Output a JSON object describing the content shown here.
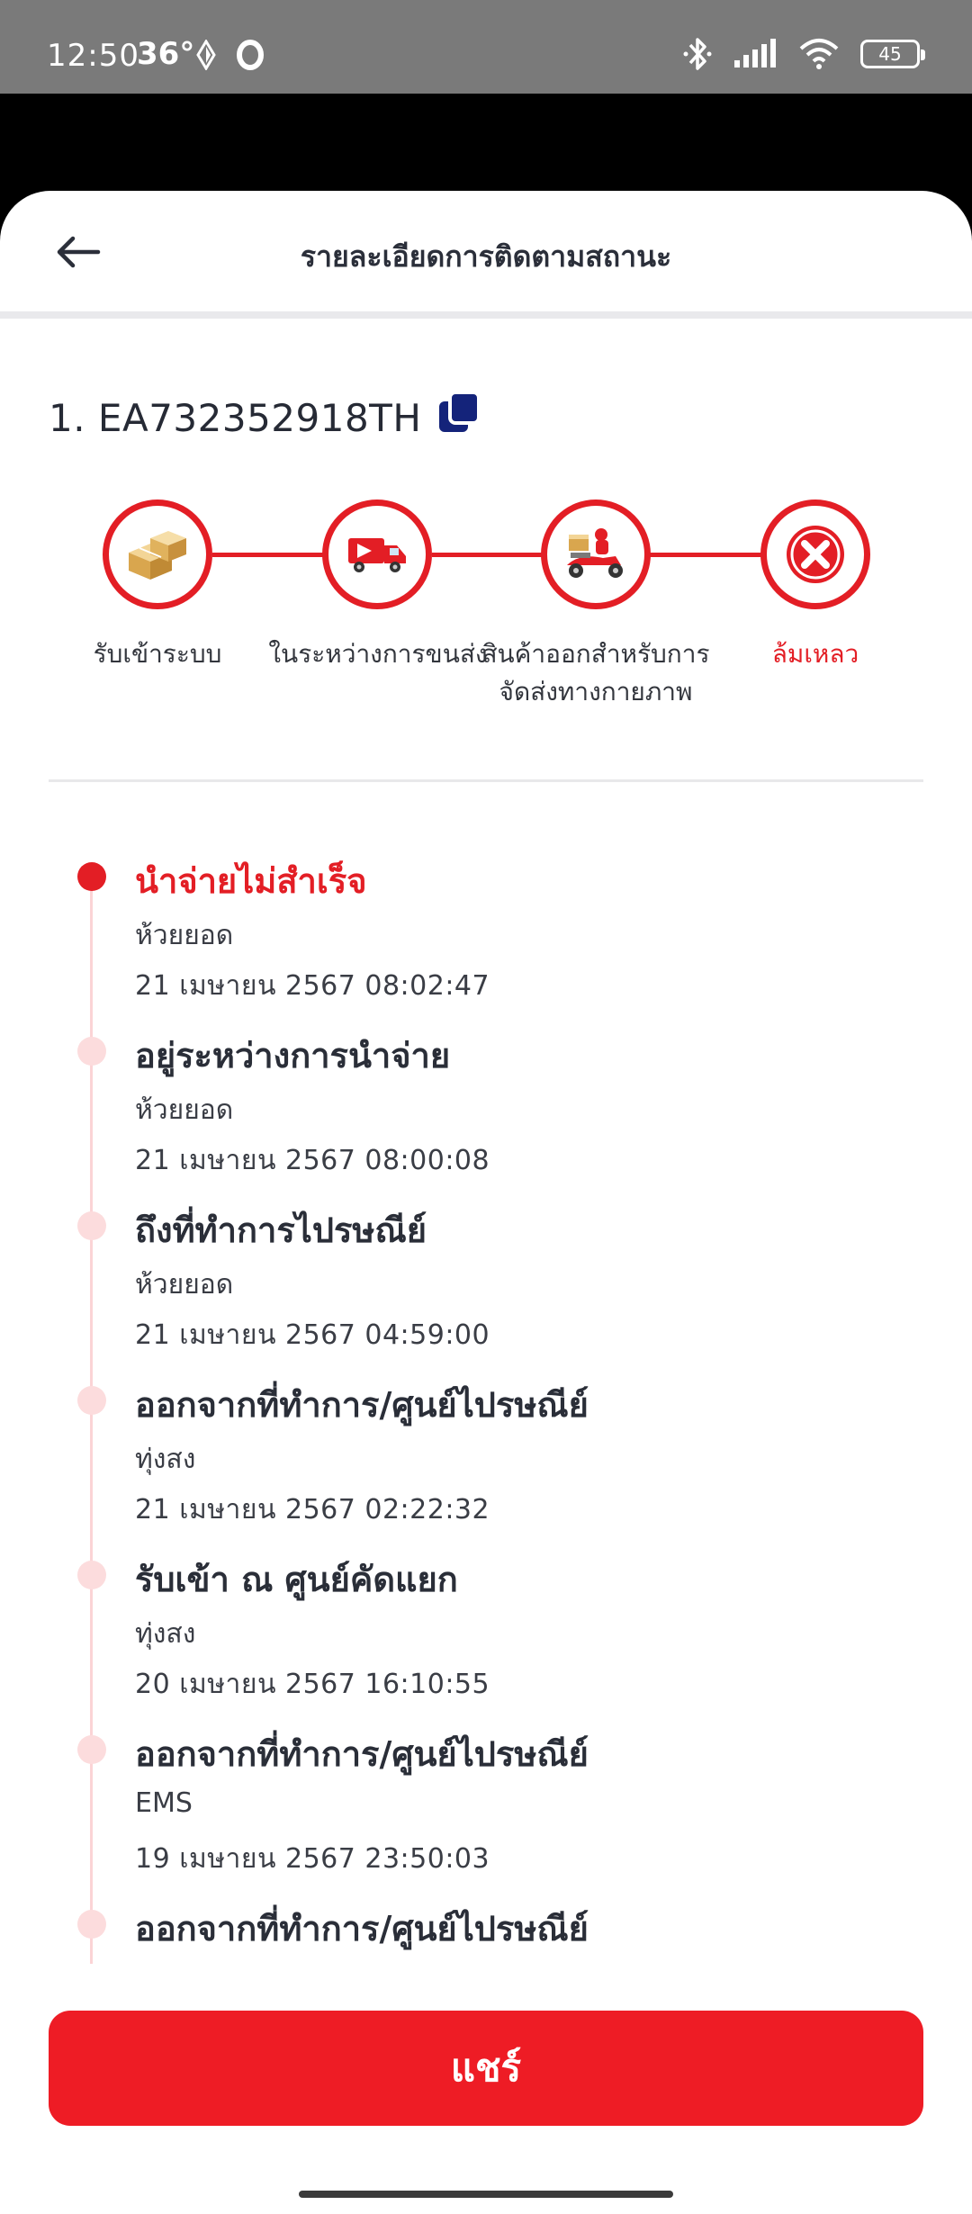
{
  "status_bar": {
    "time": "12:50",
    "temperature": "36°",
    "battery": "45"
  },
  "header": {
    "title": "รายละเอียดการติดตามสถานะ"
  },
  "tracking": {
    "number": "1. EA732352918TH"
  },
  "stepper": {
    "steps": [
      {
        "label": "รับเข้าระบบ",
        "icon": "boxes-icon"
      },
      {
        "label": "ในระหว่างการขนส่ง",
        "icon": "truck-icon"
      },
      {
        "label": "สินค้าออกสำหรับการจัดส่งทางกายภาพ",
        "icon": "delivery-scooter-icon"
      },
      {
        "label": "ล้มเหลว",
        "icon": "failed-x-icon"
      }
    ],
    "accent": "#e31e25"
  },
  "timeline": {
    "events": [
      {
        "title": "นำจ่ายไม่สำเร็จ",
        "location": "ห้วยยอด",
        "datetime": "21 เมษายน 2567 08:02:47"
      },
      {
        "title": "อยู่ระหว่างการนำจ่าย",
        "location": "ห้วยยอด",
        "datetime": "21 เมษายน 2567 08:00:08"
      },
      {
        "title": "ถึงที่ทำการไปรษณีย์",
        "location": "ห้วยยอด",
        "datetime": "21 เมษายน 2567 04:59:00"
      },
      {
        "title": "ออกจากที่ทำการ/ศูนย์ไปรษณีย์",
        "location": "ทุ่งสง",
        "datetime": "21 เมษายน 2567 02:22:32"
      },
      {
        "title": "รับเข้า ณ ศูนย์คัดแยก",
        "location": "ทุ่งสง",
        "datetime": "20 เมษายน 2567 16:10:55"
      },
      {
        "title": "ออกจากที่ทำการ/ศูนย์ไปรษณีย์",
        "location": "EMS",
        "datetime": "19 เมษายน 2567 23:50:03"
      },
      {
        "title": "ออกจากที่ทำการ/ศูนย์ไปรษณีย์",
        "location": "",
        "datetime": ""
      }
    ]
  },
  "share_button": {
    "label": "แชร์"
  }
}
